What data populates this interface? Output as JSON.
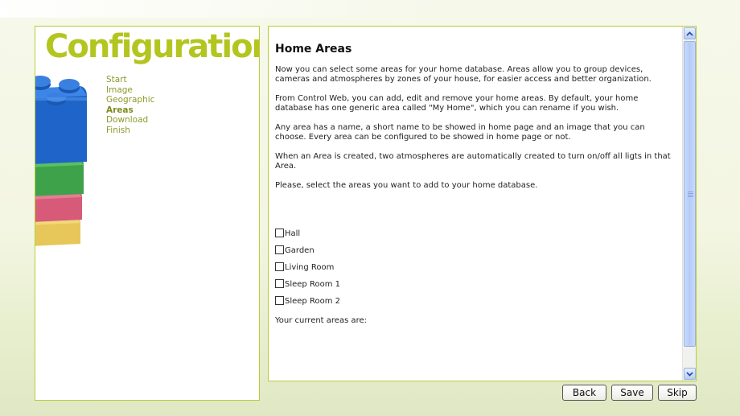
{
  "sidebar": {
    "title": "Configuration",
    "nav": [
      "Start",
      "Image",
      "Geographic",
      "Areas",
      "Download",
      "Finish"
    ],
    "active": "Areas"
  },
  "main": {
    "heading": "Home Areas",
    "paragraphs": [
      "Now you can select some areas for your home database. Areas allow you to group devices, cameras and atmospheres by zones of your house, for easier access and better organization.",
      "From Control Web, you can add, edit and remove your home areas. By default, your home database has one generic area called  \"My Home\", which you can rename if you wish.",
      "Any area has a name, a short name to be showed in home page and an image that you can choose. Every area can be configured to be showed in home page or not.",
      "When an Area is created, two atmospheres are automatically created to turn on/off all ligts in that Area.",
      "Please, select the areas you want to add to your home database."
    ],
    "areas": [
      {
        "label": "Hall",
        "checked": false
      },
      {
        "label": "Garden",
        "checked": false
      },
      {
        "label": "Living Room",
        "checked": false
      },
      {
        "label": "Sleep Room 1",
        "checked": false
      },
      {
        "label": "Sleep Room 2",
        "checked": false
      }
    ],
    "current_areas_label": "Your current areas are:"
  },
  "buttons": {
    "back": "Back",
    "save": "Save",
    "skip": "Skip"
  },
  "colors": {
    "accent": "#b3c51f",
    "border": "#b9cc3c",
    "nav_text": "#8e9a2a"
  }
}
